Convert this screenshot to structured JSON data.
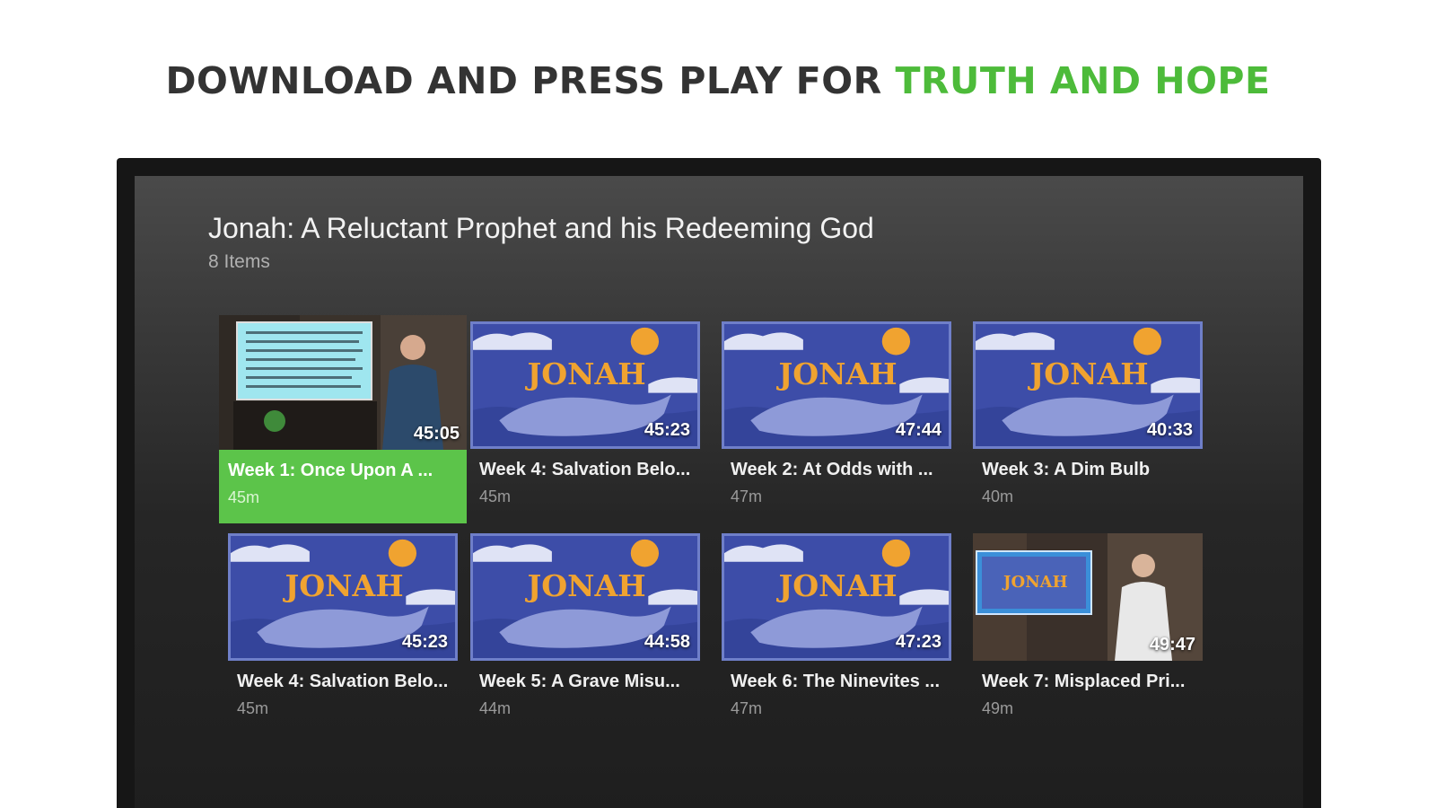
{
  "headline": {
    "prefix": "DOWNLOAD AND PRESS PLAY FOR",
    "accent": "TRUTH AND HOPE",
    "accent_color": "#4dbb3a"
  },
  "series": {
    "title": "Jonah: A Reluctant Prophet and his Redeeming God",
    "count": "8 Items"
  },
  "jonah_art_text": "JONAH",
  "episodes": [
    {
      "title": "Week 1: Once Upon A ...",
      "length": "45m",
      "duration": "45:05",
      "thumb": "sermon-slide",
      "focused": true
    },
    {
      "title": "Week 4: Salvation Belo...",
      "length": "45m",
      "duration": "45:23",
      "thumb": "jonah-art"
    },
    {
      "title": "Week 2: At Odds with ...",
      "length": "47m",
      "duration": "47:44",
      "thumb": "jonah-art"
    },
    {
      "title": "Week 3:  A Dim Bulb",
      "length": "40m",
      "duration": "40:33",
      "thumb": "jonah-art"
    },
    {
      "title": "Week 4: Salvation Belo...",
      "length": "45m",
      "duration": "45:23",
      "thumb": "jonah-art"
    },
    {
      "title": "Week 5:  A Grave Misu...",
      "length": "44m",
      "duration": "44:58",
      "thumb": "jonah-art"
    },
    {
      "title": "Week 6: The Ninevites ...",
      "length": "47m",
      "duration": "47:23",
      "thumb": "jonah-art"
    },
    {
      "title": "Week 7: Misplaced Pri...",
      "length": "49m",
      "duration": "49:47",
      "thumb": "speaker-screen"
    }
  ],
  "colors": {
    "focus_green": "#5cc44a",
    "art_blue": "#3d4da8",
    "art_orange": "#f0a330"
  }
}
